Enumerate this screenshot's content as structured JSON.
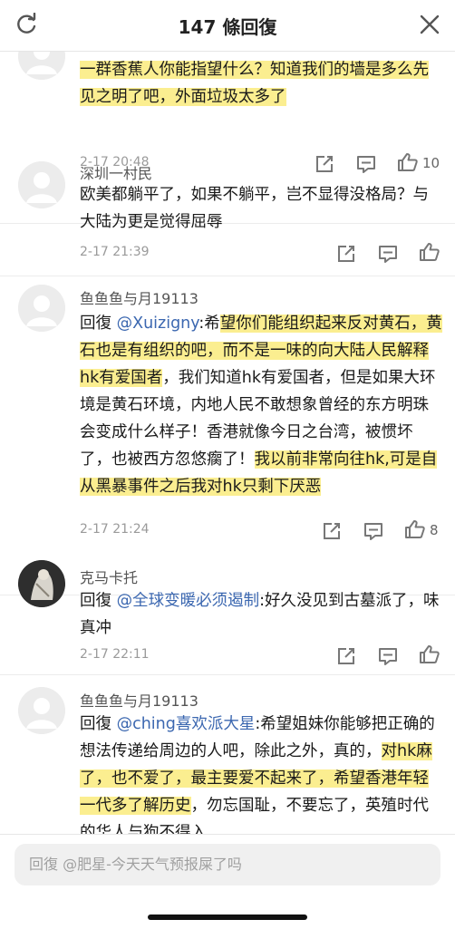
{
  "header": {
    "title": "147 條回復"
  },
  "comments": [
    {
      "name": "",
      "segments": [
        {
          "t": "一群香蕉人你能指望什么？知道我们的墙是多么先见之明了吧，外面垃圾太多了",
          "hl": true
        }
      ],
      "time": "2-17 20:48",
      "likes": "10"
    },
    {
      "name": "深圳一村民",
      "segments": [
        {
          "t": "欧美都躺平了，如果不躺平，岂不显得没格局？与大陆为更是觉得屈辱",
          "hl": false
        }
      ],
      "time": "2-17 21:39",
      "likes": ""
    },
    {
      "name": "鱼鱼鱼与月19113",
      "segments": [
        {
          "t": "回復 ",
          "hl": false
        },
        {
          "t": "@Xuizigny",
          "hl": false,
          "mention": true
        },
        {
          "t": ":希",
          "hl": false
        },
        {
          "t": "望你们能组织起来反对黄石，黄石也是有组织的吧，而不是一味的向大陆人民解释hk有爱国者",
          "hl": true
        },
        {
          "t": "，我们知道hk有爱国者，但是如果大环境是黄石环境，内地人民不敢想象曾经的东方明珠会变成什么样子！香港就像今日之台湾，被惯坏了，也被西方忽悠瘸了！",
          "hl": false
        },
        {
          "t": "我以前非常向往hk,可是自从黑暴事件之后我对hk只剩下厌恶",
          "hl": true
        }
      ],
      "time": "2-17 21:24",
      "likes": "8"
    },
    {
      "name": "克马卡托",
      "segments": [
        {
          "t": "回復 ",
          "hl": false
        },
        {
          "t": "@全球变暖必须遏制",
          "hl": false,
          "mention": true
        },
        {
          "t": ":好久没见到古墓派了，味真冲",
          "hl": false
        }
      ],
      "time": "2-17 22:11",
      "likes": ""
    },
    {
      "name": "鱼鱼鱼与月19113",
      "segments": [
        {
          "t": "回復 ",
          "hl": false
        },
        {
          "t": "@ching喜欢派大星",
          "hl": false,
          "mention": true
        },
        {
          "t": ":希望姐妹你能够把正确的想法传递给周边的人吧，除此之外，真的，",
          "hl": false
        },
        {
          "t": "对hk麻了，也不爱了，最主要爱不起来了，希望香港年轻一代多了解历史",
          "hl": true
        },
        {
          "t": "，勿忘国耻，不要忘了，英殖时代的华人与狗不得入",
          "hl": false
        }
      ],
      "time": "",
      "likes": ""
    }
  ],
  "reply": {
    "placeholder": "回復 @肥星-今天天气预报屎了吗"
  },
  "icons": {
    "refresh": "refresh-icon",
    "close": "close-icon",
    "share": "share-icon",
    "comment": "comment-icon",
    "like": "thumbs-up-icon"
  }
}
